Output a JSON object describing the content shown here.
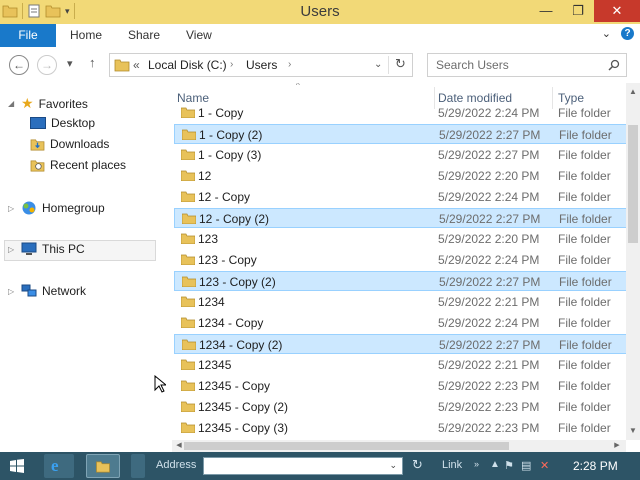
{
  "window": {
    "title": "Users"
  },
  "ribbon": {
    "file": "File",
    "tabs": [
      "Home",
      "Share",
      "View"
    ]
  },
  "address": {
    "chevron": "«",
    "parts": [
      "Local Disk (C:)",
      "Users"
    ]
  },
  "search": {
    "placeholder": "Search Users"
  },
  "nav": {
    "favorites": "Favorites",
    "favorites_items": [
      "Desktop",
      "Downloads",
      "Recent places"
    ],
    "homegroup": "Homegroup",
    "thispc": "This PC",
    "network": "Network"
  },
  "columns": {
    "name": "Name",
    "date": "Date modified",
    "type": "Type"
  },
  "files": [
    {
      "name": "1 - Copy",
      "date": "5/29/2022 2:24 PM",
      "type": "File folder",
      "selected": false
    },
    {
      "name": "1 - Copy (2)",
      "date": "5/29/2022 2:27 PM",
      "type": "File folder",
      "selected": true
    },
    {
      "name": "1 - Copy (3)",
      "date": "5/29/2022 2:27 PM",
      "type": "File folder",
      "selected": false
    },
    {
      "name": "12",
      "date": "5/29/2022 2:20 PM",
      "type": "File folder",
      "selected": false
    },
    {
      "name": "12 - Copy",
      "date": "5/29/2022 2:24 PM",
      "type": "File folder",
      "selected": false
    },
    {
      "name": "12 - Copy (2)",
      "date": "5/29/2022 2:27 PM",
      "type": "File folder",
      "selected": true
    },
    {
      "name": "123",
      "date": "5/29/2022 2:20 PM",
      "type": "File folder",
      "selected": false
    },
    {
      "name": "123 - Copy",
      "date": "5/29/2022 2:24 PM",
      "type": "File folder",
      "selected": false
    },
    {
      "name": "123 - Copy (2)",
      "date": "5/29/2022 2:27 PM",
      "type": "File folder",
      "selected": true
    },
    {
      "name": "1234",
      "date": "5/29/2022 2:21 PM",
      "type": "File folder",
      "selected": false
    },
    {
      "name": "1234 - Copy",
      "date": "5/29/2022 2:24 PM",
      "type": "File folder",
      "selected": false
    },
    {
      "name": "1234 - Copy (2)",
      "date": "5/29/2022 2:27 PM",
      "type": "File folder",
      "selected": true
    },
    {
      "name": "12345",
      "date": "5/29/2022 2:21 PM",
      "type": "File folder",
      "selected": false
    },
    {
      "name": "12345 - Copy",
      "date": "5/29/2022 2:23 PM",
      "type": "File folder",
      "selected": false
    },
    {
      "name": "12345 - Copy (2)",
      "date": "5/29/2022 2:23 PM",
      "type": "File folder",
      "selected": false
    },
    {
      "name": "12345 - Copy (3)",
      "date": "5/29/2022 2:23 PM",
      "type": "File folder",
      "selected": false
    }
  ],
  "taskbar": {
    "address_label": "Address",
    "link_label": "Link",
    "clock": "2:28 PM"
  },
  "colors": {
    "titlebar": "#f2d977",
    "file_tab": "#1979ca",
    "selection": "#cce8ff",
    "selection_border": "#99d1ff",
    "close": "#c7392b",
    "taskbar": "#2d5466",
    "folder": "#e8c25a"
  },
  "icons": [
    "folder-icon",
    "star-icon",
    "desktop-icon",
    "downloads-icon",
    "recent-places-icon",
    "homegroup-icon",
    "this-pc-icon",
    "network-icon",
    "search-icon",
    "refresh-icon",
    "back-arrow-icon",
    "forward-arrow-icon",
    "up-arrow-icon",
    "help-icon",
    "chevron-down-icon",
    "start-icon",
    "ie-icon",
    "explorer-icon",
    "flag-icon",
    "network-tray-icon",
    "volume-muted-icon"
  ]
}
